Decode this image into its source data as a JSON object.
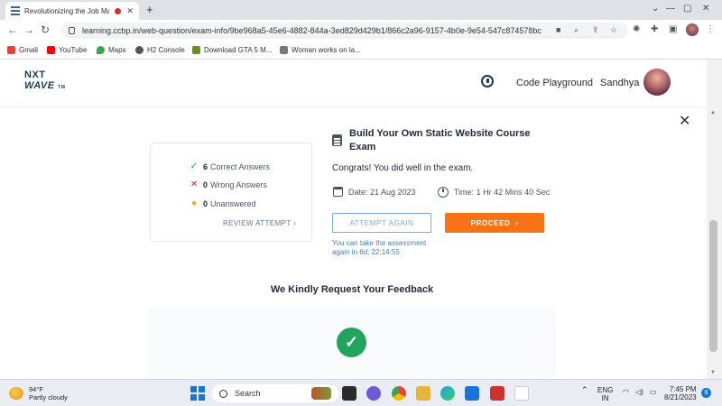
{
  "browser": {
    "tab_title": "Revolutionizing the Job Ma",
    "tab_close": "✕",
    "new_tab": "+",
    "url": "learning.ccbp.in/web-question/exam-info/9be968a5-45e6-4882-844a-3ed829d429b1/866c2a96-9157-4b0e-9e54-547c874578bc",
    "bookmarks": [
      {
        "label": "Gmail",
        "color": "#ea4335"
      },
      {
        "label": "YouTube",
        "color": "#ff0000"
      },
      {
        "label": "Maps",
        "color": "#34a853"
      },
      {
        "label": "H2 Console",
        "color": "#555555"
      },
      {
        "label": "Download GTA 5 M...",
        "color": "#6b8e23"
      },
      {
        "label": "Woman works on la...",
        "color": "#777777"
      }
    ]
  },
  "header": {
    "logo_line1": "NXT",
    "logo_line2": "WAVE",
    "logo_tm": "TM",
    "code_playground": "Code Playground",
    "user_name": "Sandhya"
  },
  "results": {
    "correct_count": "6",
    "correct_label": "Correct Answers",
    "wrong_count": "0",
    "wrong_label": "Wrong Answers",
    "unanswered_count": "0",
    "unanswered_label": "Unanswered",
    "review_label": "REVIEW ATTEMPT",
    "colors": {
      "correct": "#22a45d",
      "wrong": "#dc2626",
      "unanswered": "#f5a524"
    }
  },
  "exam": {
    "title": "Build Your Own Static Website Course Exam",
    "congrats": "Congrats! You did well in the exam.",
    "date": "Date: 21 Aug 2023",
    "time": "Time: 1 Hr 42 Mins 40 Sec",
    "attempt_again": "ATTEMPT AGAIN",
    "proceed": "PROCEED",
    "retake_note": "You can take the assessment again in 6d, 22:14:55"
  },
  "feedback": {
    "heading": "We Kindly Request Your Feedback"
  },
  "taskbar": {
    "temperature": "94°F",
    "condition": "Partly cloudy",
    "search": "Search",
    "lang_line1": "ENG",
    "lang_line2": "IN",
    "time": "7:45 PM",
    "date": "8/21/2023",
    "notifications": "6"
  }
}
